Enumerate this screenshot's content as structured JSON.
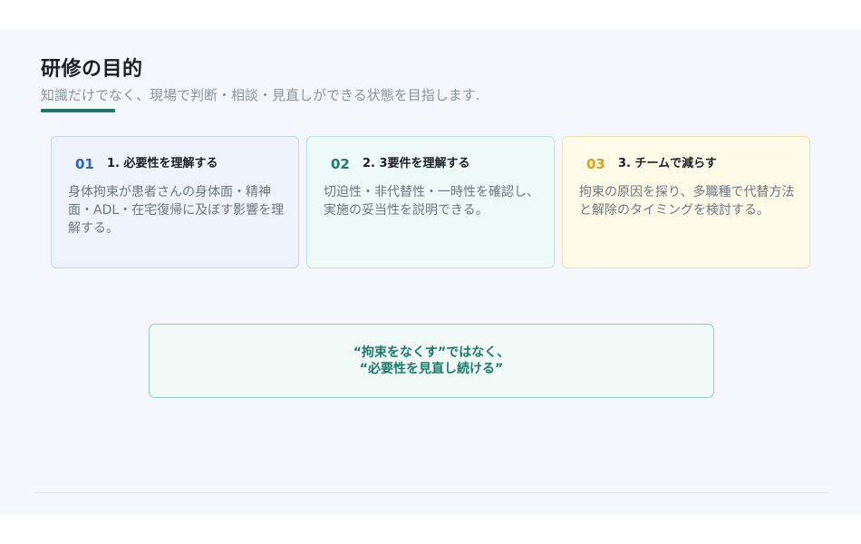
{
  "header": {
    "title": "研修の目的",
    "subtitle": "知識だけでなく、現場で判断・相談・見直しができる状態を目指します."
  },
  "cards": [
    {
      "number": "01",
      "heading": "1. 必要性を理解する",
      "body": "身体拘束が患者さんの身体面・精神面・ADL・在宅復帰に及ぼす影響を理解する。"
    },
    {
      "number": "02",
      "heading": "2. 3要件を理解する",
      "body": "切迫性・非代替性・一時性を確認し、実施の妥当性を説明できる。"
    },
    {
      "number": "03",
      "heading": "3. チームで減らす",
      "body": "拘束の原因を探り、多職種で代替方法と解除のタイミングを検討する。"
    }
  ],
  "quote": {
    "line1": "“拘束をなくす”ではなく、",
    "line2": "“必要性を見直し続ける”"
  },
  "colors": {
    "accent": "#1f7a6a",
    "card1": "#2a62c9",
    "card2": "#1f7a6a",
    "card3": "#e0a214"
  }
}
